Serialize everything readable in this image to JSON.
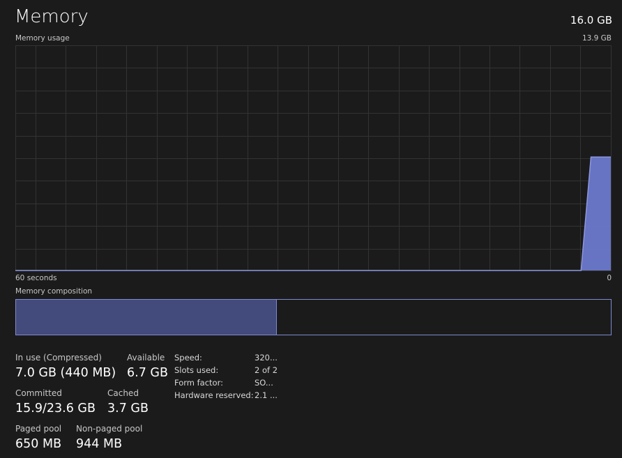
{
  "header": {
    "title": "Memory",
    "total": "16.0 GB"
  },
  "chart_data": {
    "type": "area",
    "title": "Memory usage",
    "ymax_label": "13.9 GB",
    "ylim": [
      0,
      13.9
    ],
    "xlim": [
      60,
      0
    ],
    "x_left_label": "60 seconds",
    "x_right_label": "0",
    "grid": true,
    "color": "#6b79cc",
    "series": [
      {
        "x": [
          60,
          3,
          2,
          0
        ],
        "values": [
          0,
          0,
          7.0,
          7.0
        ]
      }
    ]
  },
  "composition": {
    "label": "Memory composition",
    "in_use_gb": 7.0,
    "total_gb": 16.0,
    "fill_color": "#434a7c",
    "border_color": "#7f8ad0"
  },
  "stats": {
    "in_use": {
      "label": "In use (Compressed)",
      "value": "7.0 GB (440 MB)"
    },
    "available": {
      "label": "Available",
      "value": "6.7 GB"
    },
    "committed": {
      "label": "Committed",
      "value": "15.9/23.6 GB"
    },
    "cached": {
      "label": "Cached",
      "value": "3.7 GB"
    },
    "paged_pool": {
      "label": "Paged pool",
      "value": "650 MB"
    },
    "non_paged_pool": {
      "label": "Non-paged pool",
      "value": "944 MB"
    }
  },
  "details": [
    {
      "label": "Speed:",
      "value": "320..."
    },
    {
      "label": "Slots used:",
      "value": "2 of 2"
    },
    {
      "label": "Form factor:",
      "value": "SO..."
    },
    {
      "label": "Hardware reserved:",
      "value": "2.1 ..."
    }
  ]
}
